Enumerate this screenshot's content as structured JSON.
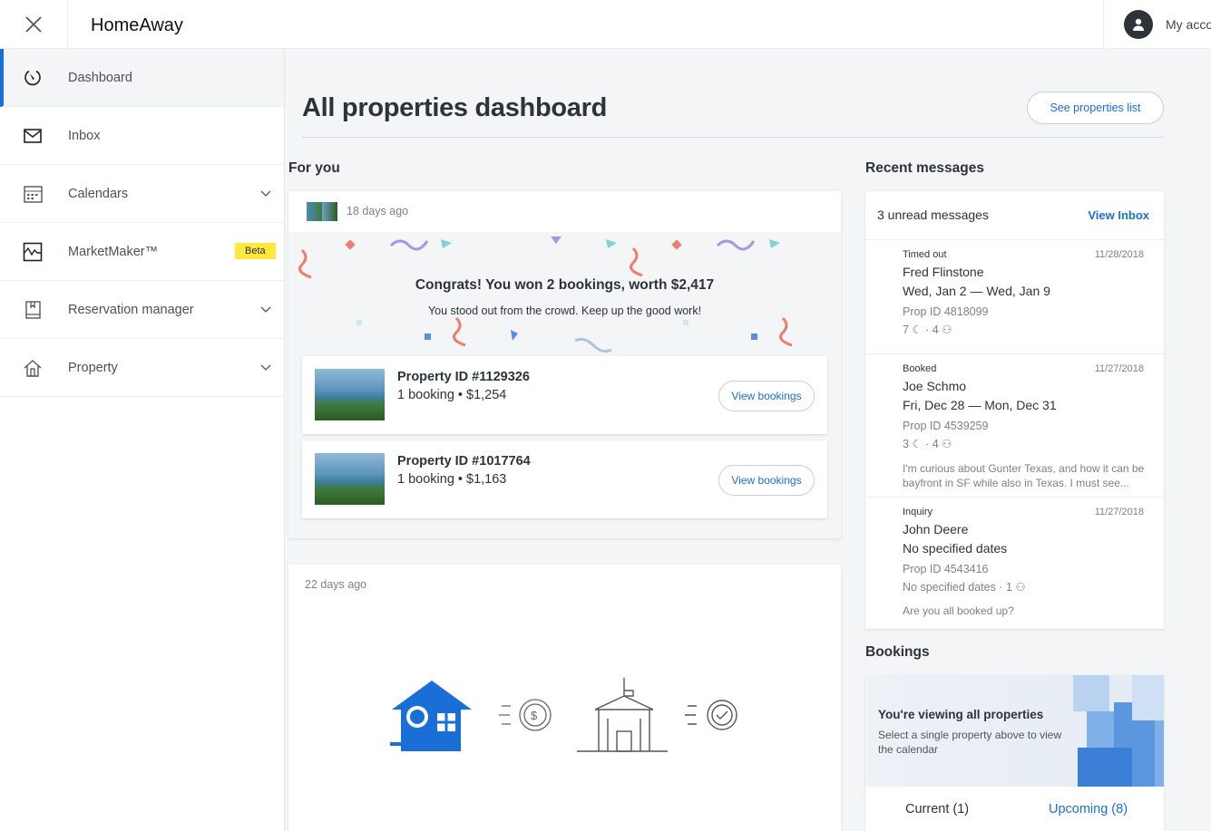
{
  "header": {
    "logo": "HomeAway",
    "account_label": "My account"
  },
  "sidebar": {
    "items": [
      {
        "label": "Dashboard",
        "icon": "dashboard-icon"
      },
      {
        "label": "Inbox",
        "icon": "envelope-icon"
      },
      {
        "label": "Calendars",
        "icon": "calendar-icon"
      },
      {
        "label": "MarketMaker™",
        "icon": "chart-pulse-icon",
        "badge": "Beta"
      },
      {
        "label": "Reservation manager",
        "icon": "book-icon"
      },
      {
        "label": "Property",
        "icon": "house-icon"
      }
    ]
  },
  "main": {
    "title": "All properties dashboard",
    "see_properties": "See properties list",
    "for_you": "For you",
    "card1": {
      "time": "18 days ago",
      "headline": "Congrats! You won 2 bookings, worth $2,417",
      "subline": "You stood out from the crowd. Keep up the good work!",
      "properties": [
        {
          "title": "Property ID #1129326",
          "sub": "1 booking • $1,254",
          "button": "View bookings"
        },
        {
          "title": "Property ID #1017764",
          "sub": "1 booking • $1,163",
          "button": "View bookings"
        }
      ]
    },
    "card2": {
      "time": "22 days ago"
    }
  },
  "recent": {
    "title": "Recent messages",
    "unread": "3 unread messages",
    "view_inbox": "View Inbox",
    "messages": [
      {
        "status": "Timed out",
        "date": "11/28/2018",
        "name": "Fred Flinstone",
        "dates": "Wed, Jan 2 — Wed, Jan 9",
        "prop": "Prop ID 4818099",
        "nights": "7",
        "guests": "4",
        "text": ""
      },
      {
        "status": "Booked",
        "date": "11/27/2018",
        "name": "Joe Schmo",
        "dates": "Fri, Dec 28 — Mon, Dec 31",
        "prop": "Prop ID 4539259",
        "nights": "3",
        "guests": "4",
        "text": "I'm curious about Gunter Texas, and how it can be bayfront in SF while also in Texas. I must see..."
      },
      {
        "status": "Inquiry",
        "date": "11/27/2018",
        "name": "John Deere",
        "dates": "No specified dates",
        "prop": "Prop ID 4543416",
        "nights": "No specified dates",
        "guests": "1",
        "text": "Are you all booked up?"
      }
    ]
  },
  "bookings": {
    "title": "Bookings",
    "heading": "You're viewing all properties",
    "sub": "Select a single property above to view the calendar",
    "tab_current": "Current (1)",
    "tab_upcoming": "Upcoming (8)"
  },
  "colors": {
    "accent": "#1a6fd6",
    "beta": "#ffe83d"
  }
}
